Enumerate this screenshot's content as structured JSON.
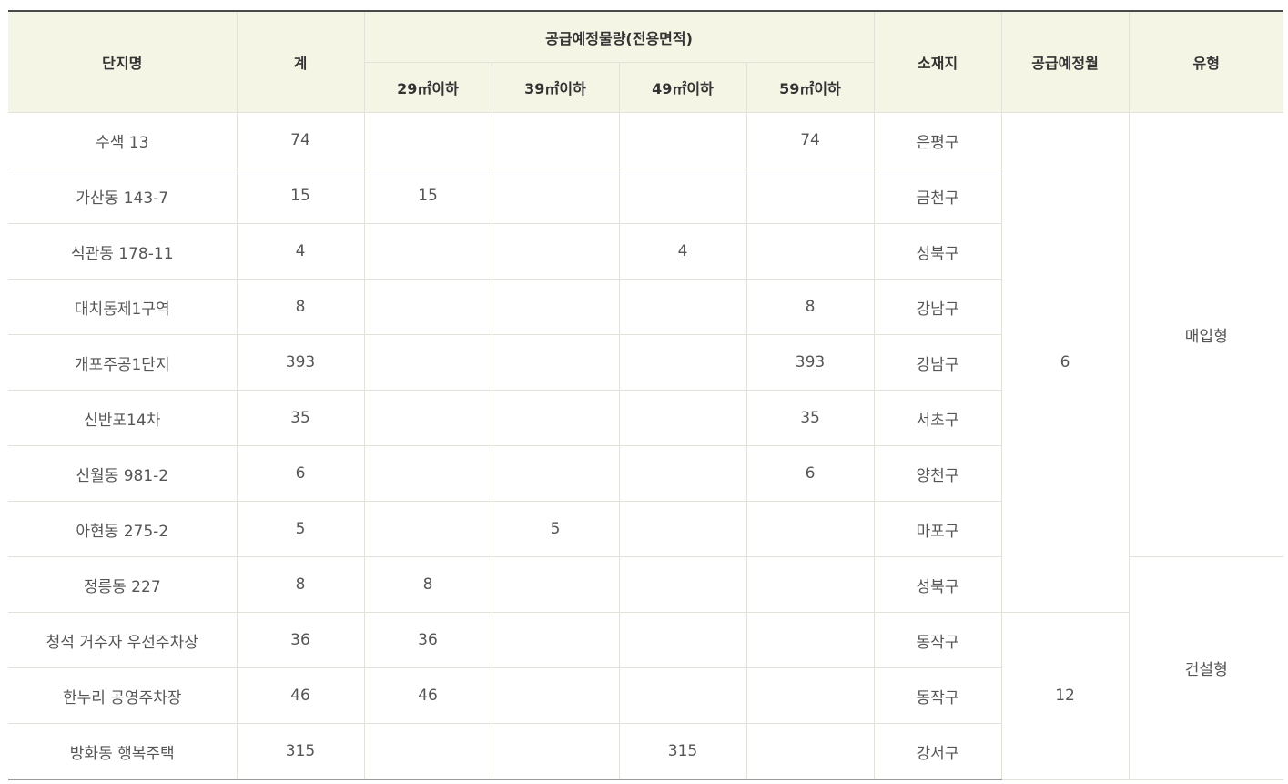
{
  "table": {
    "headers": {
      "name": "단지명",
      "total": "계",
      "supply_group": "공급예정물량(전용면적)",
      "area_29": "29㎡이하",
      "area_39": "39㎡이하",
      "area_49": "49㎡이하",
      "area_59": "59㎡이하",
      "location": "소재지",
      "month": "공급예정월",
      "type": "유형"
    },
    "rows": [
      {
        "name": "수색 13",
        "total": "74",
        "a29": "",
        "a39": "",
        "a49": "",
        "a59": "74",
        "location": "은평구"
      },
      {
        "name": "가산동 143-7",
        "total": "15",
        "a29": "15",
        "a39": "",
        "a49": "",
        "a59": "",
        "location": "금천구"
      },
      {
        "name": "석관동 178-11",
        "total": "4",
        "a29": "",
        "a39": "",
        "a49": "4",
        "a59": "",
        "location": "성북구"
      },
      {
        "name": "대치동제1구역",
        "total": "8",
        "a29": "",
        "a39": "",
        "a49": "",
        "a59": "8",
        "location": "강남구"
      },
      {
        "name": "개포주공1단지",
        "total": "393",
        "a29": "",
        "a39": "",
        "a49": "",
        "a59": "393",
        "location": "강남구"
      },
      {
        "name": "신반포14차",
        "total": "35",
        "a29": "",
        "a39": "",
        "a49": "",
        "a59": "35",
        "location": "서초구"
      },
      {
        "name": "신월동 981-2",
        "total": "6",
        "a29": "",
        "a39": "",
        "a49": "",
        "a59": "6",
        "location": "양천구"
      },
      {
        "name": "아현동 275-2",
        "total": "5",
        "a29": "",
        "a39": "5",
        "a49": "",
        "a59": "",
        "location": "마포구"
      },
      {
        "name": "정릉동 227",
        "total": "8",
        "a29": "8",
        "a39": "",
        "a49": "",
        "a59": "",
        "location": "성북구"
      },
      {
        "name": "청석 거주자 우선주차장",
        "total": "36",
        "a29": "36",
        "a39": "",
        "a49": "",
        "a59": "",
        "location": "동작구"
      },
      {
        "name": "한누리 공영주차장",
        "total": "46",
        "a29": "46",
        "a39": "",
        "a49": "",
        "a59": "",
        "location": "동작구"
      },
      {
        "name": "방화동 행복주택",
        "total": "315",
        "a29": "",
        "a39": "",
        "a49": "315",
        "a59": "",
        "location": "강서구"
      }
    ],
    "month_groups": [
      "6",
      "12"
    ],
    "type_groups": [
      "매입형",
      "건설형"
    ]
  },
  "colors": {
    "header_bg": "#f5f5e6",
    "border": "#e2e2da",
    "top_rule": "#4a4a4a",
    "text": "#555555",
    "header_text": "#333333"
  }
}
